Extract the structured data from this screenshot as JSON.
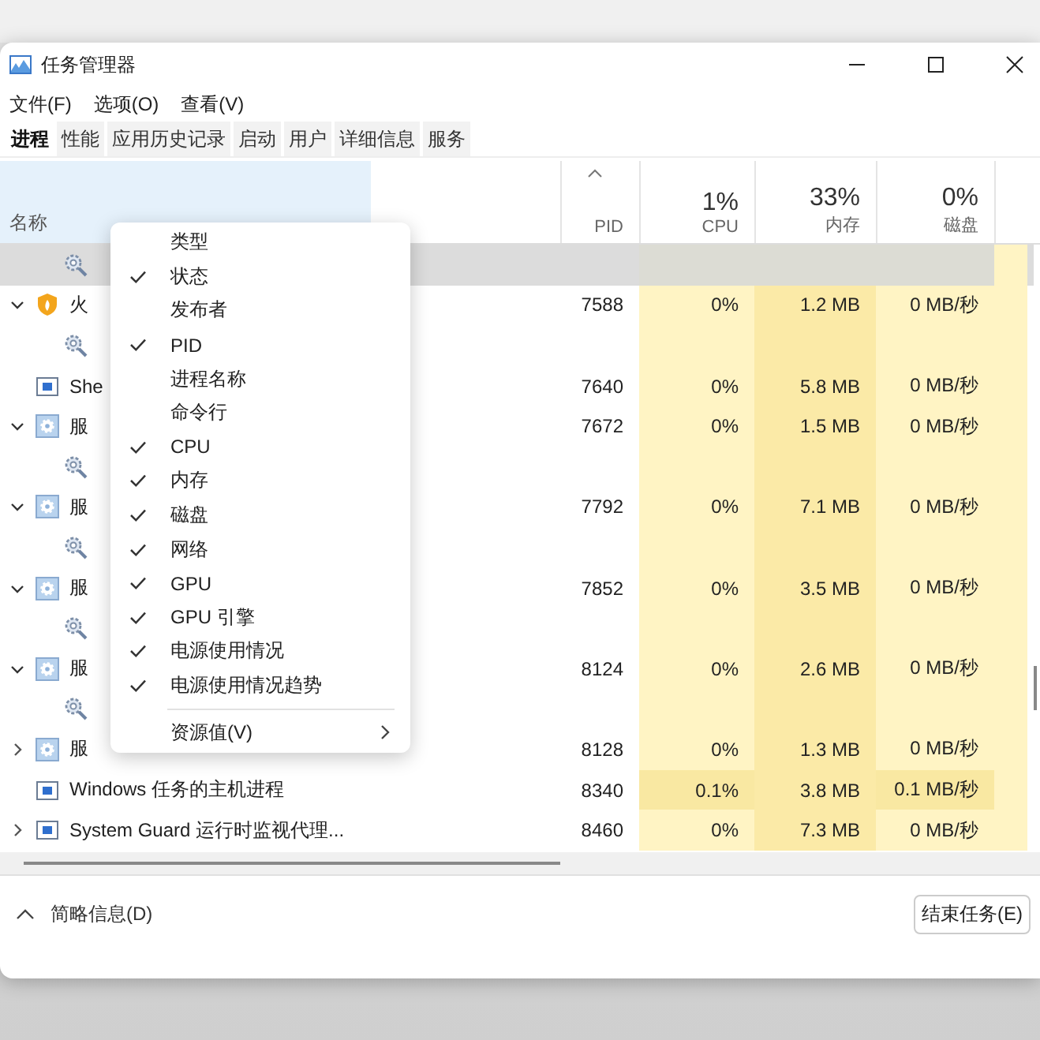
{
  "window": {
    "title": "任务管理器"
  },
  "menu_bar": [
    "文件(F)",
    "选项(O)",
    "查看(V)"
  ],
  "tabs": [
    {
      "label": "进程",
      "selected": true
    },
    {
      "label": "性能",
      "selected": false
    },
    {
      "label": "应用历史记录",
      "selected": false
    },
    {
      "label": "启动",
      "selected": false
    },
    {
      "label": "用户",
      "selected": false
    },
    {
      "label": "详细信息",
      "selected": false
    },
    {
      "label": "服务",
      "selected": false
    }
  ],
  "table": {
    "columns": [
      {
        "label": "名称",
        "kind": "name"
      },
      {
        "label": "PID",
        "kind": "pid",
        "sorted": true
      },
      {
        "percent": "1%",
        "label": "CPU",
        "kind": "cpu"
      },
      {
        "percent": "33%",
        "label": "内存",
        "kind": "memory"
      },
      {
        "percent": "0%",
        "label": "磁盘",
        "kind": "disk"
      }
    ],
    "rows": [
      {
        "kind": "service",
        "selected": true
      },
      {
        "name": "火",
        "kind": "security",
        "expanded": true,
        "selected": false,
        "pid": "7588",
        "cpu": "0%",
        "memory": "1.2 MB",
        "disk": "0 MB/秒",
        "cpu_hot": false,
        "disk_hot": false,
        "children": [
          {
            "kind": "service",
            "selected": false
          }
        ]
      },
      {
        "name": "She",
        "kind": "app",
        "selected": false,
        "pid": "7640",
        "cpu": "0%",
        "memory": "5.8 MB",
        "disk": "0 MB/秒",
        "cpu_hot": false,
        "disk_hot": false
      },
      {
        "name": "服",
        "kind": "group",
        "expanded": true,
        "selected": false,
        "pid": "7672",
        "cpu": "0%",
        "memory": "1.5 MB",
        "disk": "0 MB/秒",
        "cpu_hot": false,
        "disk_hot": false,
        "children": [
          {
            "kind": "service",
            "selected": false
          }
        ]
      },
      {
        "name": "服",
        "kind": "group",
        "expanded": true,
        "selected": false,
        "pid": "7792",
        "cpu": "0%",
        "memory": "7.1 MB",
        "disk": "0 MB/秒",
        "cpu_hot": false,
        "disk_hot": false,
        "children": [
          {
            "kind": "service",
            "selected": false
          }
        ]
      },
      {
        "name": "服",
        "kind": "group",
        "expanded": true,
        "selected": false,
        "pid": "7852",
        "cpu": "0%",
        "memory": "3.5 MB",
        "disk": "0 MB/秒",
        "cpu_hot": false,
        "disk_hot": false,
        "children": [
          {
            "kind": "service",
            "selected": false
          }
        ]
      },
      {
        "name": "服",
        "kind": "group",
        "expanded": true,
        "selected": false,
        "pid": "8124",
        "cpu": "0%",
        "memory": "2.6 MB",
        "disk": "0 MB/秒",
        "cpu_hot": false,
        "disk_hot": false,
        "children": [
          {
            "kind": "service",
            "selected": false
          }
        ]
      },
      {
        "name": "服",
        "kind": "group",
        "expanded": false,
        "selected": false,
        "pid": "8128",
        "cpu": "0%",
        "memory": "1.3 MB",
        "disk": "0 MB/秒",
        "cpu_hot": false,
        "disk_hot": false
      },
      {
        "name": "Windows 任务的主机进程",
        "kind": "app",
        "selected": false,
        "pid": "8340",
        "cpu": "0.1%",
        "memory": "3.8 MB",
        "disk": "0.1 MB/秒",
        "cpu_hot": true,
        "disk_hot": true
      },
      {
        "name": "System Guard 运行时监视代理...",
        "kind": "app",
        "expanded": false,
        "selected": false,
        "pid": "8460",
        "cpu": "0%",
        "memory": "7.3 MB",
        "disk": "0 MB/秒",
        "cpu_hot": false,
        "disk_hot": false
      }
    ]
  },
  "context_menu": [
    {
      "label": "类型",
      "kind": "check",
      "checked": false
    },
    {
      "label": "状态",
      "kind": "check",
      "checked": true
    },
    {
      "label": "发布者",
      "kind": "check",
      "checked": false
    },
    {
      "label": "PID",
      "kind": "check",
      "checked": true
    },
    {
      "label": "进程名称",
      "kind": "check",
      "checked": false
    },
    {
      "label": "命令行",
      "kind": "check",
      "checked": false
    },
    {
      "label": "CPU",
      "kind": "check",
      "checked": true
    },
    {
      "label": "内存",
      "kind": "check",
      "checked": true
    },
    {
      "label": "磁盘",
      "kind": "check",
      "checked": true
    },
    {
      "label": "网络",
      "kind": "check",
      "checked": true
    },
    {
      "label": "GPU",
      "kind": "check",
      "checked": true
    },
    {
      "label": "GPU 引擎",
      "kind": "check",
      "checked": true
    },
    {
      "label": "电源使用情况",
      "kind": "check",
      "checked": true
    },
    {
      "label": "电源使用情况趋势",
      "kind": "check",
      "checked": true
    },
    {
      "label": "资源值(V)",
      "kind": "submenu",
      "checked": false
    }
  ],
  "footer": {
    "details_toggle": "简略信息(D)",
    "end_task_button": "结束任务(E)"
  }
}
